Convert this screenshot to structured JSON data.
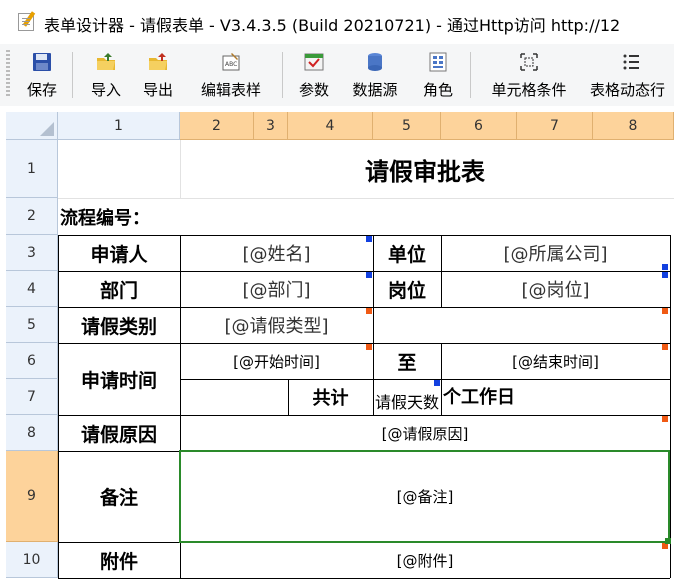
{
  "window": {
    "title": "表单设计器 - 请假表单 - V3.4.3.5 (Build 20210721) - 通过Http访问 http://12"
  },
  "toolbar": {
    "buttons": [
      {
        "label": "保存",
        "icon": "save-icon"
      },
      {
        "label": "导入",
        "icon": "import-folder-icon"
      },
      {
        "label": "导出",
        "icon": "export-folder-icon"
      },
      {
        "label": "编辑表样",
        "icon": "edit-template-icon"
      },
      {
        "label": "参数",
        "icon": "parameter-icon"
      },
      {
        "label": "数据源",
        "icon": "database-icon"
      },
      {
        "label": "角色",
        "icon": "role-icon"
      },
      {
        "label": "单元格条件",
        "icon": "cell-condition-icon"
      },
      {
        "label": "表格动态行",
        "icon": "dynamic-row-icon"
      }
    ]
  },
  "sheet": {
    "columns": [
      "1",
      "2",
      "3",
      "4",
      "5",
      "6",
      "7",
      "8"
    ],
    "rows": [
      "1",
      "2",
      "3",
      "4",
      "5",
      "6",
      "7",
      "8",
      "9",
      "10"
    ],
    "cells": {
      "title": "请假审批表",
      "flow_no_label": "流程编号：",
      "applicant_label": "申请人",
      "applicant_value": "[@姓名]",
      "unit_label": "单位",
      "unit_value": "[@所属公司]",
      "dept_label": "部门",
      "dept_value": "[@部门]",
      "post_label": "岗位",
      "post_value": "[@岗位]",
      "leave_type_label": "请假类别",
      "leave_type_value": "[@请假类型]",
      "apply_time_label": "申请时间",
      "start_time_value": "[@开始时间]",
      "to_label": "至",
      "end_time_value": "[@结束时间]",
      "total_label": "共计",
      "days_value": "请假天数",
      "workdays_label": "个工作日",
      "reason_label": "请假原因",
      "reason_value": "[@请假原因]",
      "remark_label": "备注",
      "remark_value": "[@备注]",
      "attach_label": "附件",
      "attach_value": "[@附件]"
    }
  }
}
